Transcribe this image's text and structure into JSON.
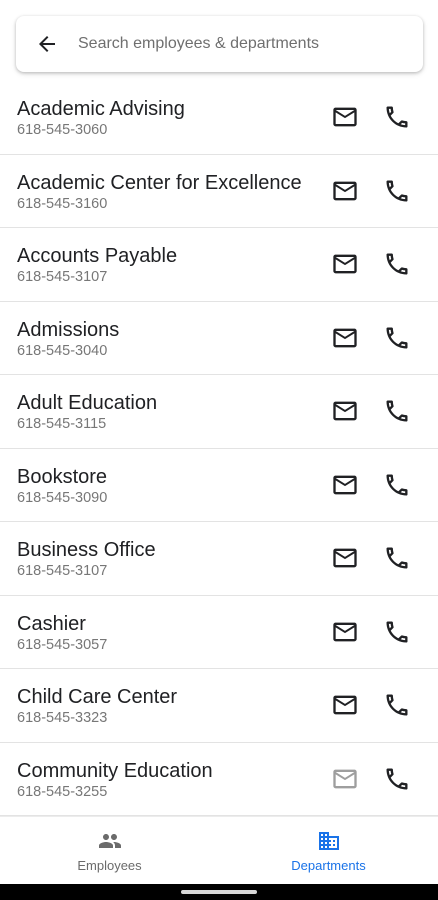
{
  "search": {
    "placeholder": "Search employees & departments",
    "value": ""
  },
  "departments": [
    {
      "name": "Academic Advising",
      "phone": "618-545-3060",
      "has_email": true
    },
    {
      "name": "Academic Center for Excellence",
      "phone": "618-545-3160",
      "has_email": true
    },
    {
      "name": "Accounts Payable",
      "phone": "618-545-3107",
      "has_email": true
    },
    {
      "name": "Admissions",
      "phone": "618-545-3040",
      "has_email": true
    },
    {
      "name": "Adult Education",
      "phone": "618-545-3115",
      "has_email": true
    },
    {
      "name": "Bookstore",
      "phone": "618-545-3090",
      "has_email": true
    },
    {
      "name": "Business Office",
      "phone": "618-545-3107",
      "has_email": true
    },
    {
      "name": "Cashier",
      "phone": "618-545-3057",
      "has_email": true
    },
    {
      "name": "Child Care Center",
      "phone": "618-545-3323",
      "has_email": true
    },
    {
      "name": "Community Education",
      "phone": "618-545-3255",
      "has_email": false
    }
  ],
  "nav": {
    "employees": {
      "label": "Employees",
      "icon": "people-icon",
      "active": false
    },
    "departments": {
      "label": "Departments",
      "icon": "building-icon",
      "active": true
    }
  },
  "colors": {
    "accent": "#1a73e8",
    "icon": "#202124",
    "icon_disabled": "#9e9e9e",
    "text_secondary": "#777777"
  }
}
